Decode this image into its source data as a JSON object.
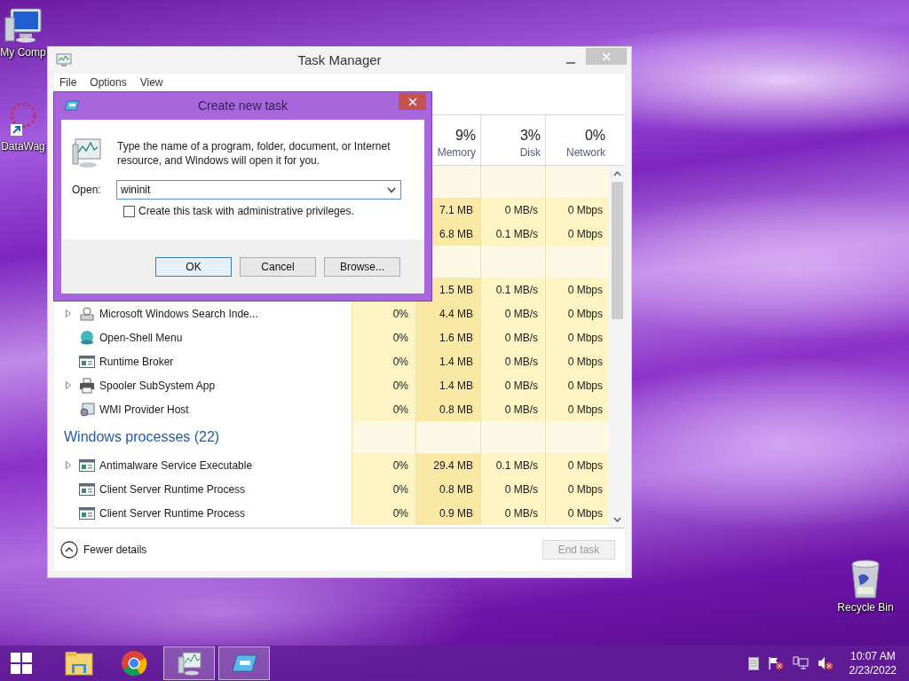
{
  "desktop": {
    "icons": [
      {
        "kind": "computer",
        "label": "My Comp"
      },
      {
        "kind": "shortcut",
        "label": "DataWag"
      },
      {
        "kind": "recycle-bin",
        "label": "Recycle Bin"
      }
    ]
  },
  "task_manager": {
    "title": "Task Manager",
    "menu": [
      "File",
      "Options",
      "View"
    ],
    "columns": [
      {
        "percent": "9%",
        "label": "Memory"
      },
      {
        "percent": "3%",
        "label": "Disk"
      },
      {
        "percent": "0%",
        "label": "Network"
      }
    ],
    "rows": [
      {
        "kind": "group"
      },
      {
        "kind": "process",
        "memory": "7.1 MB",
        "disk": "0 MB/s",
        "network": "0 Mbps"
      },
      {
        "kind": "process",
        "memory": "6.8 MB",
        "disk": "0.1 MB/s",
        "network": "0 Mbps"
      },
      {
        "kind": "group"
      },
      {
        "kind": "process",
        "memory": "1.5 MB",
        "disk": "0.1 MB/s",
        "network": "0 Mbps"
      },
      {
        "kind": "process",
        "name": "Microsoft Windows Search Inde...",
        "expandable": true,
        "cpu": "0%",
        "memory": "4.4 MB",
        "disk": "0 MB/s",
        "network": "0 Mbps"
      },
      {
        "kind": "process",
        "name": "Open-Shell Menu",
        "cpu": "0%",
        "memory": "1.6 MB",
        "disk": "0 MB/s",
        "network": "0 Mbps"
      },
      {
        "kind": "process",
        "name": "Runtime Broker",
        "cpu": "0%",
        "memory": "1.4 MB",
        "disk": "0 MB/s",
        "network": "0 Mbps"
      },
      {
        "kind": "process",
        "name": "Spooler SubSystem App",
        "expandable": true,
        "cpu": "0%",
        "memory": "1.4 MB",
        "disk": "0 MB/s",
        "network": "0 Mbps"
      },
      {
        "kind": "process",
        "name": "WMI Provider Host",
        "cpu": "0%",
        "memory": "0.8 MB",
        "disk": "0 MB/s",
        "network": "0 Mbps"
      },
      {
        "kind": "group",
        "name": "Windows processes (22)"
      },
      {
        "kind": "process",
        "name": "Antimalware Service Executable",
        "expandable": true,
        "cpu": "0%",
        "memory": "29.4 MB",
        "disk": "0.1 MB/s",
        "network": "0 Mbps"
      },
      {
        "kind": "process",
        "name": "Client Server Runtime Process",
        "cpu": "0%",
        "memory": "0.8 MB",
        "disk": "0 MB/s",
        "network": "0 Mbps"
      },
      {
        "kind": "process",
        "name": "Client Server Runtime Process",
        "cpu": "0%",
        "memory": "0.9 MB",
        "disk": "0 MB/s",
        "network": "0 Mbps"
      }
    ],
    "footer": {
      "toggle": "Fewer details",
      "end_task": {
        "label": "End task",
        "disabled": true
      }
    }
  },
  "dialog": {
    "title": "Create new task",
    "message": "Type the name of a program, folder, document, or Internet resource, and Windows will open it for you.",
    "open_label": "Open:",
    "value": "wininit",
    "checkbox": {
      "label": "Create this task with administrative privileges.",
      "checked": false
    },
    "buttons": [
      {
        "label": "OK",
        "default": true
      },
      {
        "label": "Cancel",
        "default": false
      },
      {
        "label": "Browse...",
        "default": false
      }
    ]
  },
  "taskbar": {
    "items": [
      {
        "kind": "start",
        "active": false
      },
      {
        "kind": "explorer",
        "active": false
      },
      {
        "kind": "browser",
        "active": false
      },
      {
        "kind": "task-manager",
        "active": true
      },
      {
        "kind": "run",
        "active": true
      }
    ],
    "tray": [
      {
        "kind": "action-center"
      },
      {
        "kind": "flag"
      },
      {
        "kind": "network"
      },
      {
        "kind": "volume"
      }
    ],
    "time": "10:07 AM",
    "date": "2/23/2022"
  }
}
